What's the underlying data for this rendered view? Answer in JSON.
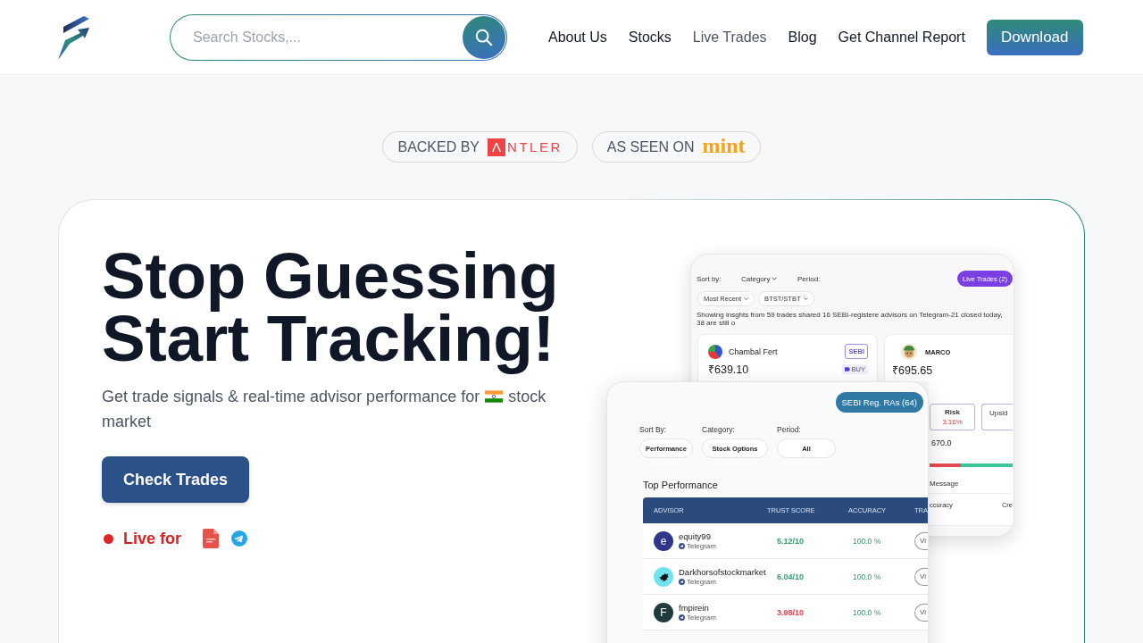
{
  "header": {
    "search": {
      "placeholder": "Search Stocks,..."
    },
    "nav": [
      {
        "label": "About Us",
        "selected": false
      },
      {
        "label": "Stocks",
        "selected": false
      },
      {
        "label": "Live Trades",
        "selected": true
      },
      {
        "label": "Blog",
        "selected": false
      },
      {
        "label": "Get Channel Report",
        "selected": false
      }
    ],
    "download_button": "Download"
  },
  "badges": [
    {
      "kind": "tile",
      "label": "BACKED BY",
      "logo_mark": "Λ",
      "logo_text": "NTLER"
    },
    {
      "kind": "wordmark",
      "label": "AS SEEN ON",
      "logo_text": "mint"
    }
  ],
  "hero": {
    "title_lines": [
      "Stop Guessing",
      "Start Tracking!"
    ],
    "subtitle": {
      "before_flag": "Get trade signals & real-time advisor performance for",
      "after_flag": "stock",
      "next_line": "market"
    },
    "cta": "Check Trades",
    "live_label": "Live for"
  },
  "preview_back": {
    "filters": [
      {
        "text": "Sort by:",
        "dropdown": false
      },
      {
        "text": "Category",
        "dropdown": true
      },
      {
        "text": "Period:",
        "dropdown": false
      }
    ],
    "live_button": "Live Trades (2)",
    "chips": [
      "Most Recent",
      "BTST/STBT"
    ],
    "summary": "Showing insghts from 59 trades shared 16 SEBI-registere advisors on Telegram-21 closed today, 38 are still o",
    "stock_card": {
      "name": "Chambal Fert",
      "tag": "SEBI",
      "price": "₹639.10",
      "signal": "BUY"
    },
    "advisor_card": {
      "name": "MARCO",
      "price": "₹695.65",
      "risk_label": "Risk",
      "risk_value": "3.16%",
      "upside_label": "Upsid",
      "target": "670.0",
      "message_label": "Message",
      "stats": [
        "ccuracy",
        "Cre"
      ]
    }
  },
  "preview_front": {
    "ra_button": "SEBI Reg. RAs (64)",
    "filters": [
      {
        "label": "Sort By:",
        "value": "Performance"
      },
      {
        "label": "Category:",
        "value": "Stock Options"
      },
      {
        "label": "Period:",
        "value": "All"
      }
    ],
    "section_title": "Top Performance",
    "columns": [
      "ADVISOR",
      "TRUST SCORE",
      "ACCURACY",
      "TRA"
    ],
    "rows": [
      {
        "avatar": {
          "kind": "letter",
          "text": "e",
          "color": "#30378a"
        },
        "name": "equity99",
        "source": "Telegram",
        "trust_score": {
          "text": "5.12/10",
          "color": "#3a9d6e"
        },
        "accuracy": "100.0 %",
        "action": "Vi"
      },
      {
        "avatar": {
          "kind": "image",
          "color": "#6fe3f0"
        },
        "name": "Darkhorsofstockmarket",
        "source": "Telegram",
        "trust_score": {
          "text": "6.04/10",
          "color": "#3a9d6e"
        },
        "accuracy": "100.0 %",
        "action": "Vi"
      },
      {
        "avatar": {
          "kind": "letter",
          "text": "F",
          "color": "#1f3b3e"
        },
        "name": "fmpirein",
        "source": "Telegram",
        "trust_score": {
          "text": "3.98/10",
          "color": "#e0454f"
        },
        "accuracy": "100.0 %",
        "action": "Vi"
      }
    ]
  }
}
